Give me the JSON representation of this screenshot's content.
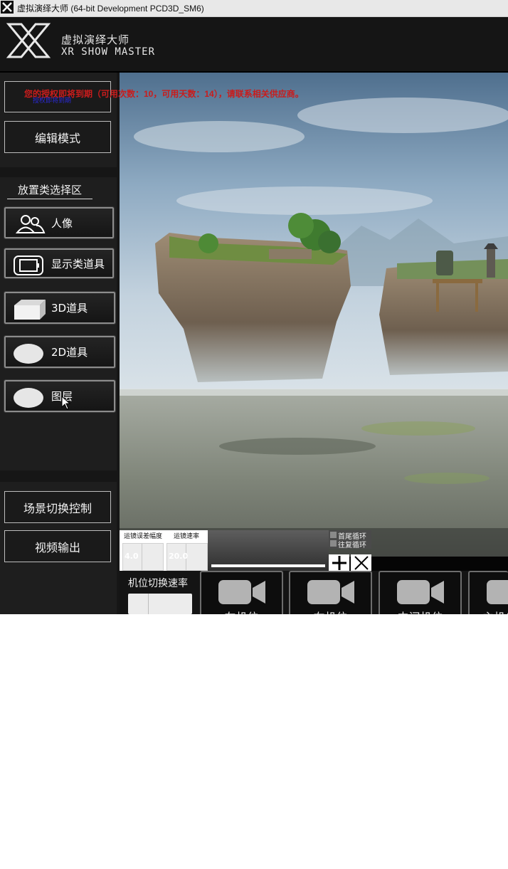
{
  "window": {
    "title": "虚拟演绎大师 (64-bit Development PCD3D_SM6)"
  },
  "brand": {
    "name_cn": "虚拟演绎大师",
    "name_en": "XR SHOW MASTER"
  },
  "notice": {
    "text": "您的授权即将到期（可用次数：10，可用天数：14），请联系相关供应商。",
    "overlap_text": "授权即将到期"
  },
  "mode": {
    "edit_label": "编辑模式"
  },
  "placement": {
    "title": "放置类选择区",
    "items": [
      {
        "label": "人像",
        "icon": "people-icon"
      },
      {
        "label": "显示类道具",
        "icon": "display-icon"
      },
      {
        "label": "3D道具",
        "icon": "cube-icon"
      },
      {
        "label": "2D道具",
        "icon": "ellipse-icon"
      },
      {
        "label": "图层",
        "icon": "ellipse-icon"
      }
    ]
  },
  "bottom_nav": {
    "scene_switch": "场景切换控制",
    "video_output": "视频输出"
  },
  "motion": {
    "error_label": "运镜误差幅度",
    "error_value": "4.0",
    "speed_label": "运镜速率",
    "speed_value": "20.0",
    "loop_head_tail": "首尾循环",
    "loop_back_forth": "往复循环",
    "add_symbol": "+",
    "close_symbol": "×"
  },
  "camera": {
    "switch_speed_label": "机位切换速率",
    "cams": [
      "左机位",
      "右机位",
      "中间机位",
      "主机位"
    ]
  },
  "colors": {
    "app_bg": "#161616",
    "warning": "#c91c1c",
    "button_border": "#bdbdbd"
  }
}
